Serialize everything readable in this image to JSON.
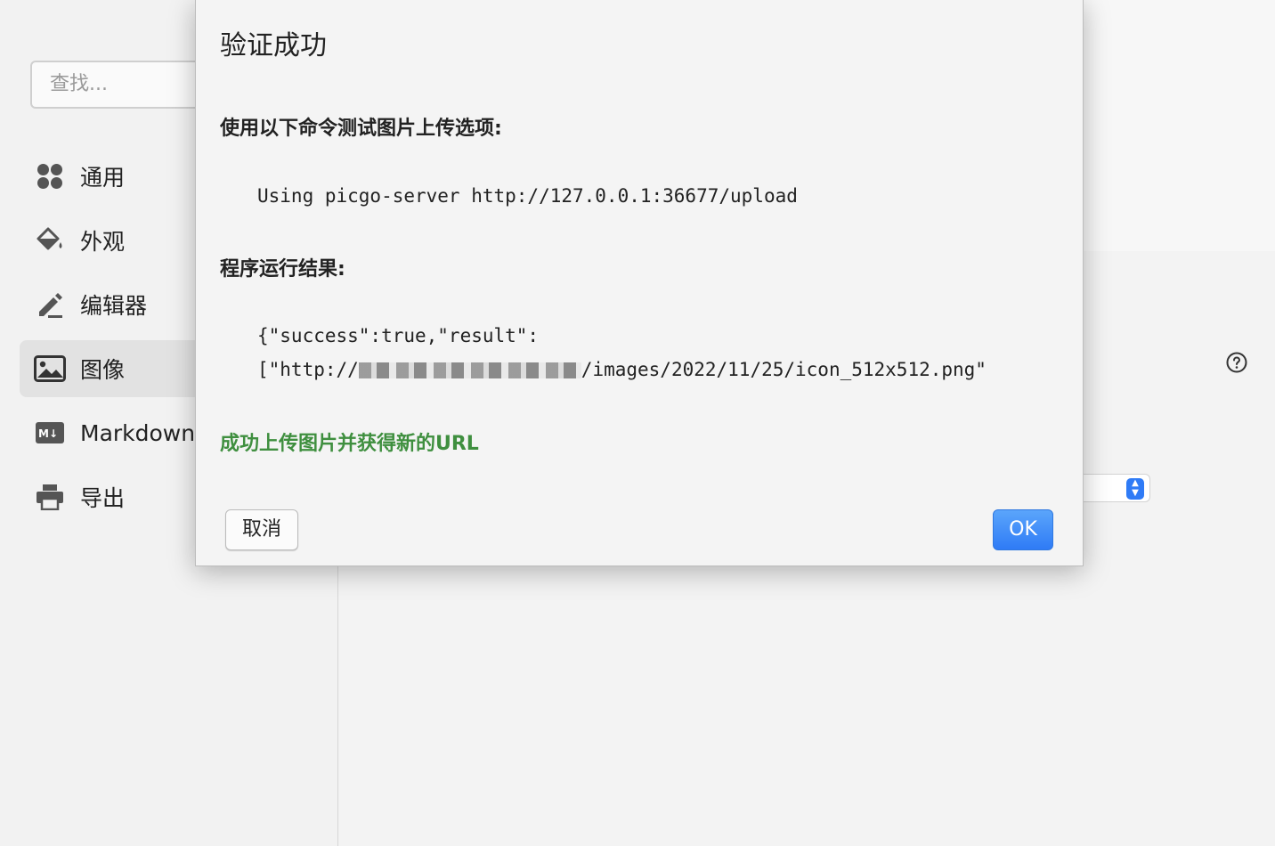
{
  "sidebar": {
    "search_placeholder": "查找...",
    "items": [
      {
        "label": "通用",
        "icon": "grid-icon"
      },
      {
        "label": "外观",
        "icon": "paint-bucket-icon"
      },
      {
        "label": "编辑器",
        "icon": "pencil-icon"
      },
      {
        "label": "图像",
        "icon": "image-icon",
        "active": true
      },
      {
        "label": "Markdown",
        "icon": "markdown-icon"
      },
      {
        "label": "导出",
        "icon": "printer-icon"
      }
    ]
  },
  "dialog": {
    "title": "验证成功",
    "command_heading": "使用以下命令测试图片上传选项:",
    "command": "Using picgo-server http://127.0.0.1:36677/upload",
    "result_heading": "程序运行结果:",
    "result_line1": "{\"success\":true,\"result\":",
    "result_line2_prefix": "[\"http://",
    "result_line2_suffix": "/images/2022/11/25/icon_512x512.png\"",
    "success_message": "成功上传图片并获得新的URL",
    "cancel_label": "取消",
    "ok_label": "OK"
  },
  "colors": {
    "success_green": "#3f8f3f",
    "accent_blue": "#2f7bf6",
    "close_red": "#ee6a5f"
  }
}
